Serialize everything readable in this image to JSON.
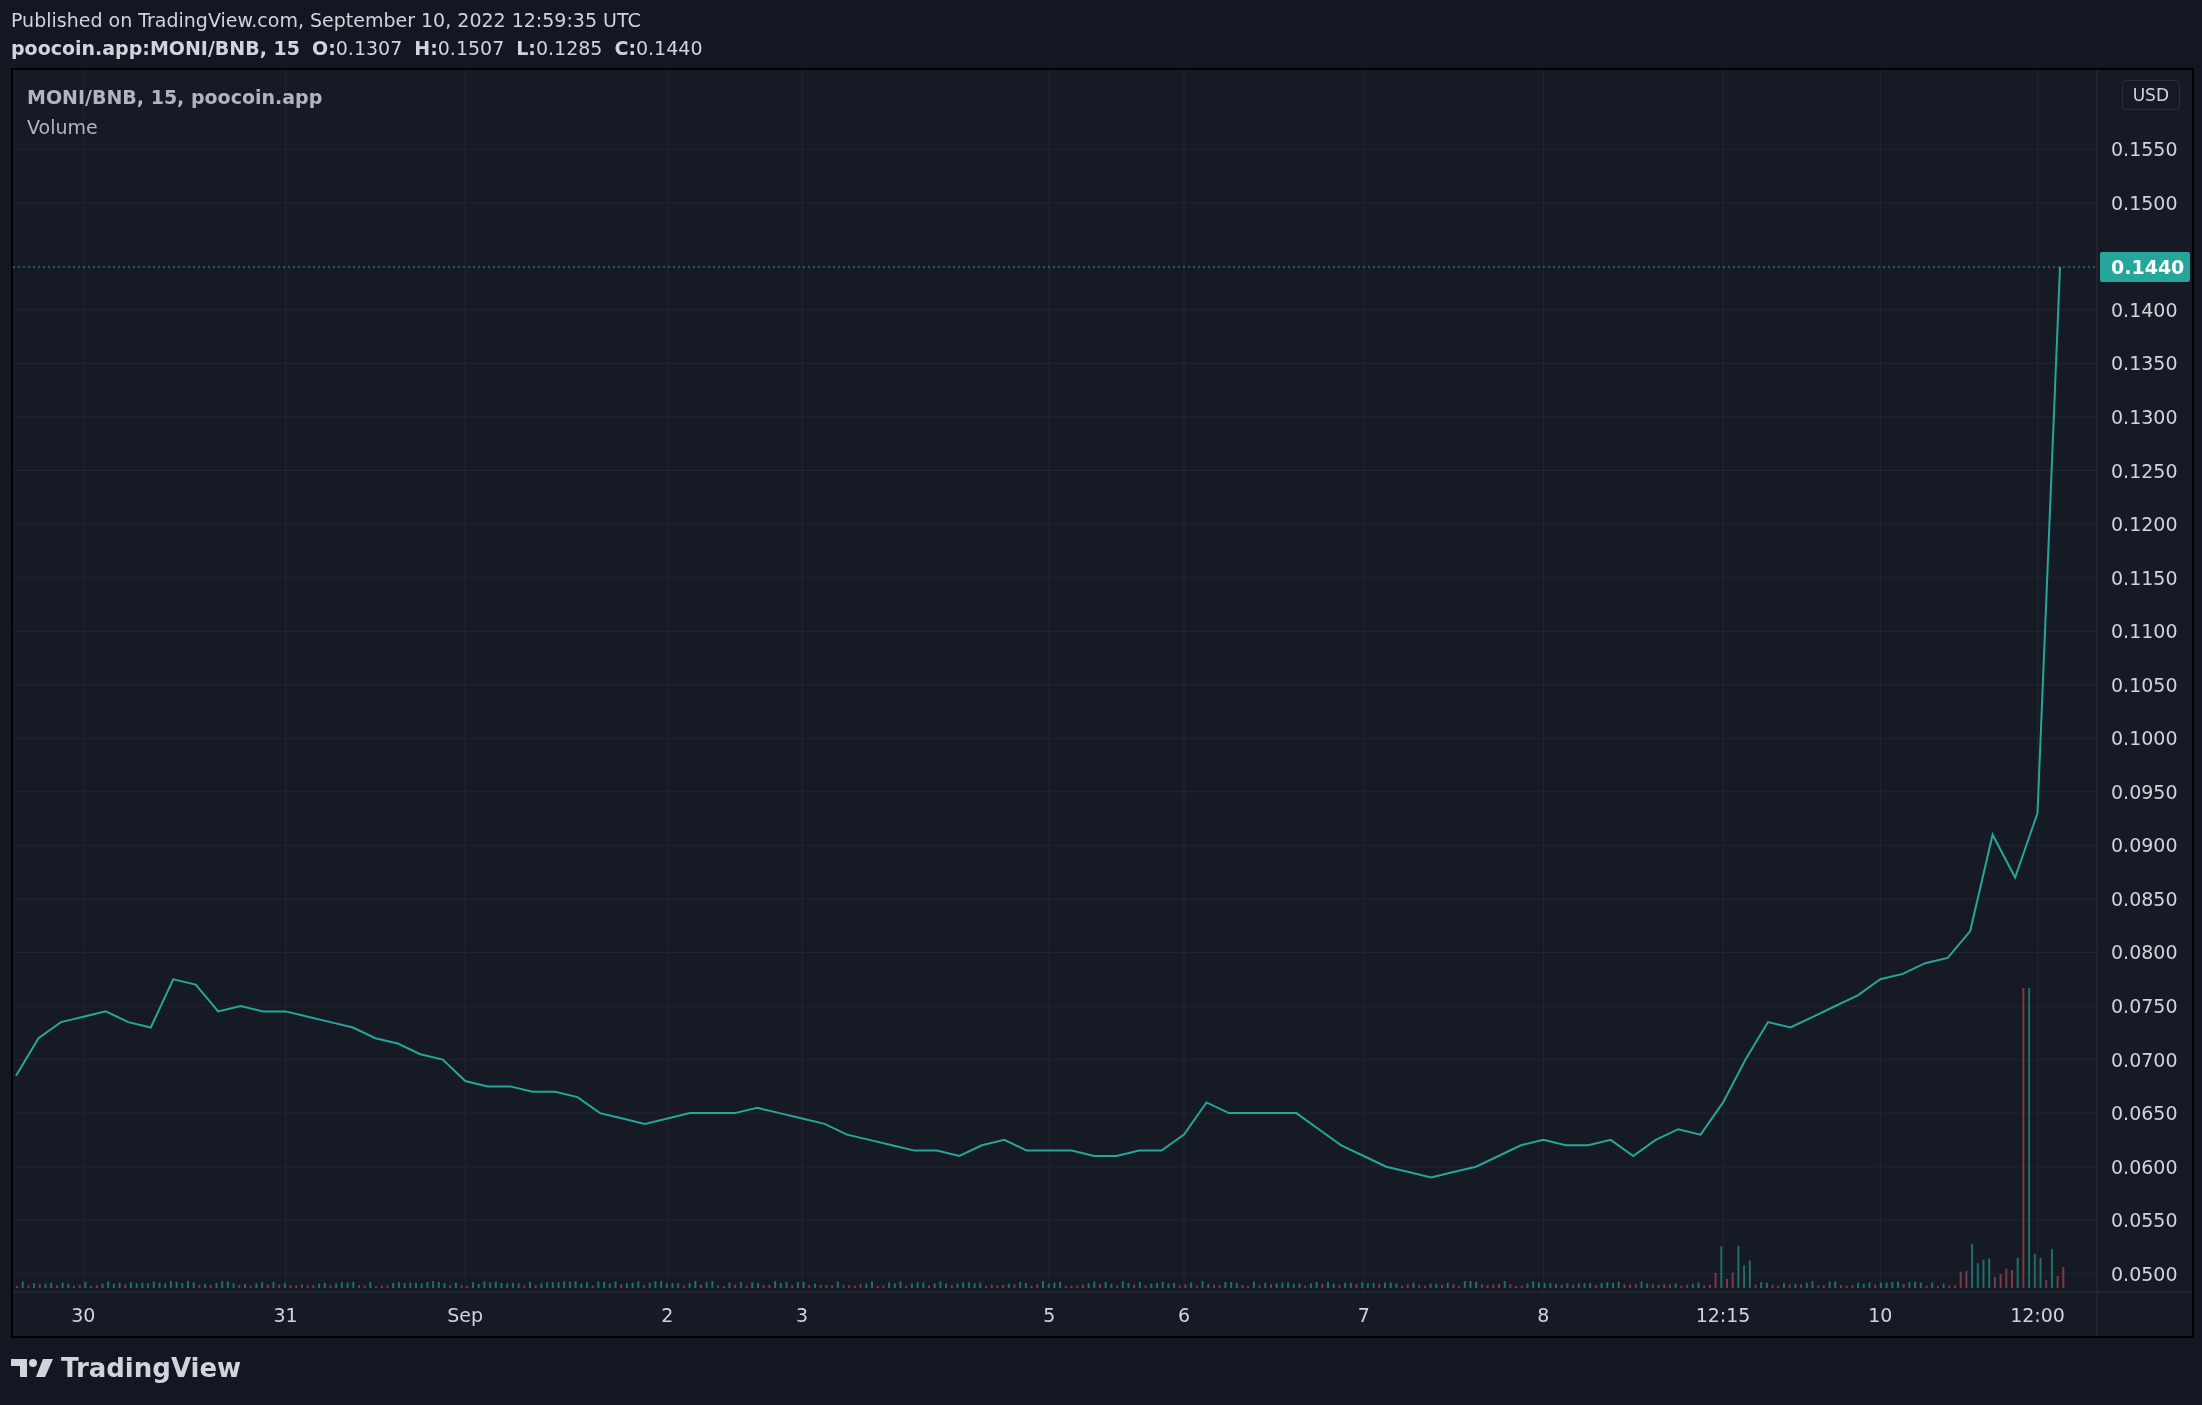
{
  "published": "Published on TradingView.com, September 10, 2022 12:59:35 UTC",
  "symbol_line": {
    "symbol": "poocoin.app:MONI/BNB, 15",
    "ohlc": [
      {
        "label": "O:",
        "value": "0.1307"
      },
      {
        "label": "H:",
        "value": "0.1507"
      },
      {
        "label": "L:",
        "value": "0.1285"
      },
      {
        "label": "C:",
        "value": "0.1440"
      }
    ]
  },
  "chart": {
    "legend": [
      "MONI/BNB, 15, poocoin.app",
      "Volume"
    ],
    "currency_button": "USD",
    "last_price_label": "0.1440",
    "chart_data": {
      "type": "line",
      "grid": true,
      "ylim": [
        0.0483,
        0.1624
      ],
      "ref_lines": [
        {
          "axis": "y",
          "value": 0.144
        }
      ],
      "categories": [
        null,
        null,
        null,
        "30",
        null,
        null,
        null,
        null,
        null,
        null,
        null,
        null,
        "31",
        null,
        null,
        null,
        null,
        null,
        null,
        null,
        "Sep",
        null,
        null,
        null,
        null,
        null,
        null,
        null,
        null,
        "2",
        null,
        null,
        null,
        null,
        null,
        "3",
        null,
        null,
        null,
        null,
        null,
        null,
        null,
        null,
        null,
        null,
        "5",
        null,
        null,
        null,
        null,
        null,
        "6",
        null,
        null,
        null,
        null,
        null,
        null,
        null,
        "7",
        null,
        null,
        null,
        null,
        null,
        null,
        null,
        "8",
        null,
        null,
        null,
        null,
        null,
        null,
        null,
        "12:15",
        null,
        null,
        null,
        null,
        null,
        null,
        "10",
        null,
        null,
        null,
        null,
        null,
        null,
        "12:00",
        null
      ],
      "series": [
        {
          "color": "#26a69a",
          "values": [
            0.0685,
            0.072,
            0.0735,
            0.074,
            0.0745,
            0.0735,
            0.073,
            0.0775,
            0.077,
            0.0745,
            0.075,
            0.0745,
            0.0745,
            0.074,
            0.0735,
            0.073,
            0.072,
            0.0715,
            0.0705,
            0.07,
            0.068,
            0.0675,
            0.0675,
            0.067,
            0.067,
            0.0665,
            0.065,
            0.0645,
            0.064,
            0.0645,
            0.065,
            0.065,
            0.065,
            0.0655,
            0.065,
            0.0645,
            0.064,
            0.063,
            0.0625,
            0.062,
            0.0615,
            0.0615,
            0.061,
            0.062,
            0.0625,
            0.0615,
            0.0615,
            0.0615,
            0.061,
            0.061,
            0.0615,
            0.0615,
            0.063,
            0.066,
            0.065,
            0.065,
            0.065,
            0.065,
            0.0635,
            0.062,
            0.061,
            0.06,
            0.0595,
            0.059,
            0.0595,
            0.06,
            0.061,
            0.062,
            0.0625,
            0.062,
            0.062,
            0.0625,
            0.061,
            0.0625,
            0.0635,
            0.063,
            0.066,
            0.07,
            0.0735,
            0.073,
            0.074,
            0.075,
            0.076,
            0.0775,
            0.078,
            0.079,
            0.0795,
            0.082,
            0.091,
            0.087,
            0.093,
            0.144
          ]
        }
      ],
      "yticks": [
        {
          "value": 0.05,
          "label": "0.0500"
        },
        {
          "value": 0.055,
          "label": "0.0550"
        },
        {
          "value": 0.06,
          "label": "0.0600"
        },
        {
          "value": 0.065,
          "label": "0.0650"
        },
        {
          "value": 0.07,
          "label": "0.0700"
        },
        {
          "value": 0.075,
          "label": "0.0750"
        },
        {
          "value": 0.08,
          "label": "0.0800"
        },
        {
          "value": 0.085,
          "label": "0.0850"
        },
        {
          "value": 0.09,
          "label": "0.0900"
        },
        {
          "value": 0.095,
          "label": "0.0950"
        },
        {
          "value": 0.1,
          "label": "0.1000"
        },
        {
          "value": 0.105,
          "label": "0.1050"
        },
        {
          "value": 0.11,
          "label": "0.1100"
        },
        {
          "value": 0.115,
          "label": "0.1150"
        },
        {
          "value": 0.12,
          "label": "0.1200"
        },
        {
          "value": 0.125,
          "label": "0.1250"
        },
        {
          "value": 0.13,
          "label": "0.1300"
        },
        {
          "value": 0.135,
          "label": "0.1350"
        },
        {
          "value": 0.14,
          "label": "0.1400"
        },
        {
          "value": 0.15,
          "label": "0.1500"
        },
        {
          "value": 0.155,
          "label": "0.1550"
        }
      ]
    }
  },
  "footer": {
    "brand": "TradingView"
  }
}
